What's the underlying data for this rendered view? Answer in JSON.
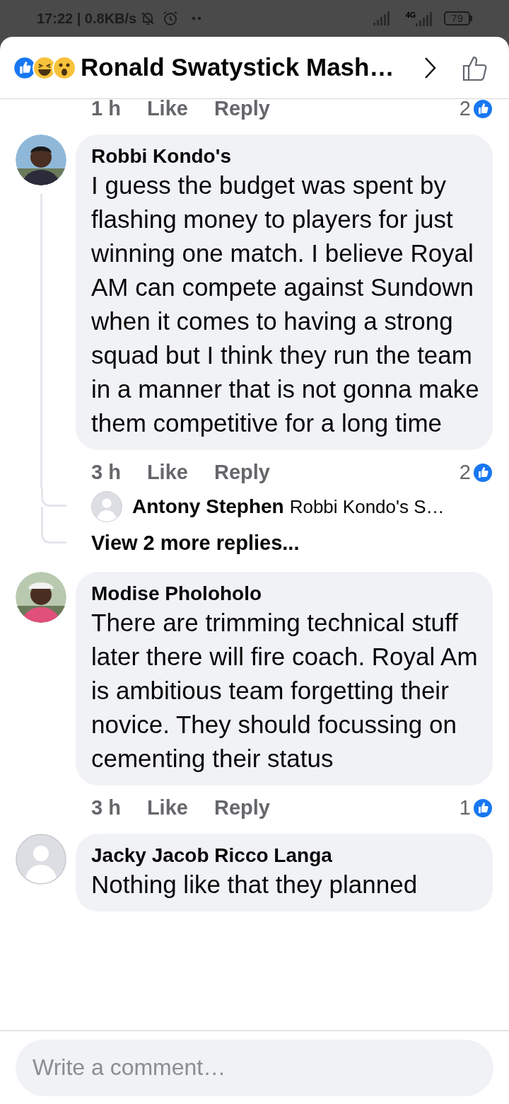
{
  "status_bar": {
    "time": "17:22 | 0.8KB/s",
    "network": "4G",
    "battery": "79"
  },
  "header": {
    "title": "Ronald Swatystick Mash…"
  },
  "top_meta": {
    "time": "1 h",
    "like": "Like",
    "reply": "Reply",
    "likes": "2"
  },
  "comments": [
    {
      "author": "Robbi Kondo's",
      "photo": true,
      "text": "I guess the budget was spent by flashing money to players for just winning one match. I believe Royal AM can compete against Sundown when it comes to having a strong squad but I think they run the team in a manner that is not gonna make them competitive for a long time",
      "meta": {
        "time": "3 h",
        "like": "Like",
        "reply": "Reply",
        "likes": "2"
      },
      "replies": {
        "preview": {
          "author": "Antony Stephen",
          "text": "Robbi Kondo's S…"
        },
        "more": "View 2 more replies..."
      }
    },
    {
      "author": "Modise Pholoholo",
      "photo": true,
      "text": "There are trimming technical stuff later there will fire coach. Royal Am is ambitious team forgetting their novice. They should focussing on cementing their status",
      "meta": {
        "time": "3 h",
        "like": "Like",
        "reply": "Reply",
        "likes": "1"
      }
    },
    {
      "author": "Jacky Jacob Ricco Langa",
      "photo": false,
      "text": "Nothing like that they planned"
    }
  ],
  "composer": {
    "placeholder": "Write a comment…"
  }
}
